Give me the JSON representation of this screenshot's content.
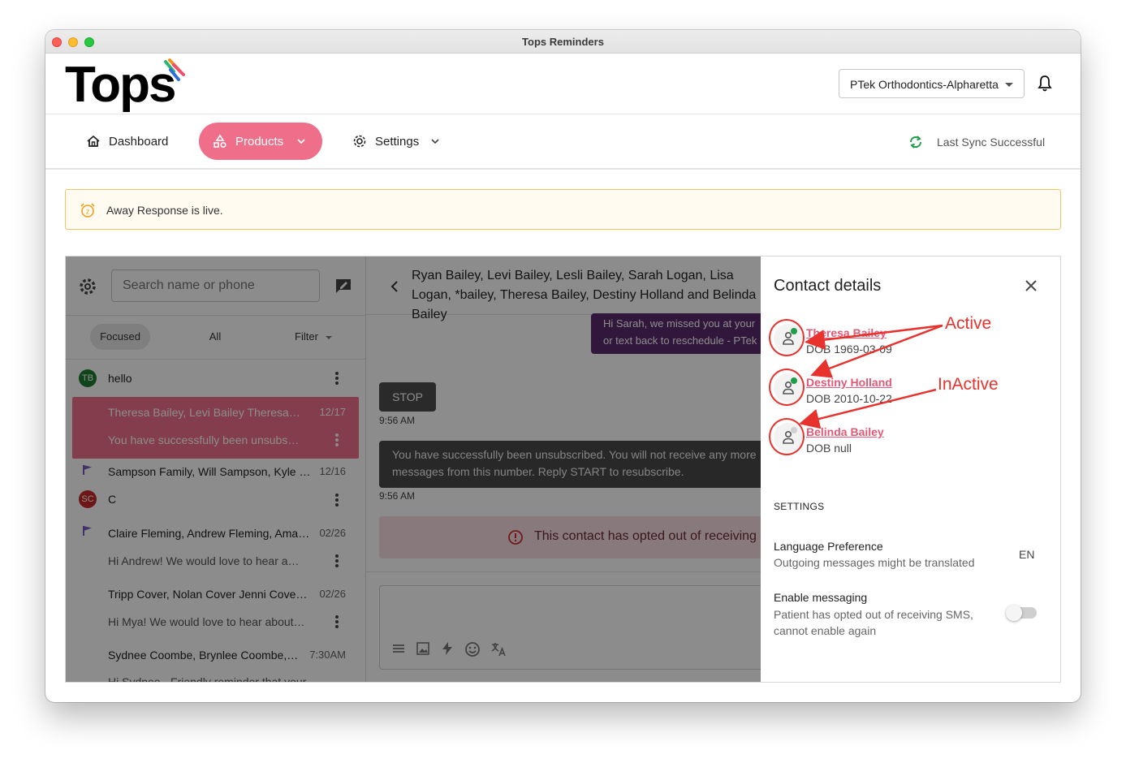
{
  "window": {
    "title": "Tops Reminders"
  },
  "header": {
    "logo_text": "Tops",
    "practice_selector": "PTek Orthodontics-Alpharetta"
  },
  "nav": {
    "dashboard": "Dashboard",
    "products": "Products",
    "settings": "Settings",
    "sync_status": "Last Sync Successful"
  },
  "banner": {
    "text": "Away Response is live."
  },
  "inbox": {
    "search_placeholder": "Search name or phone",
    "tabs": [
      "Focused",
      "All",
      "Filter"
    ],
    "conversations": [
      {
        "avatar": "TB",
        "avatar_color": "#1e7e34",
        "name": "hello",
        "date": "",
        "preview": ""
      },
      {
        "name": "Theresa Bailey, Levi Bailey Theresa Bailey",
        "date": "12/17",
        "preview": "You have successfully been unsubscribed. You will"
      },
      {
        "flag": true,
        "name": "Sampson Family, Will Sampson, Kyle Sampson",
        "date": "12/16",
        "preview": ""
      },
      {
        "avatar": "SC",
        "avatar_color": "#c62828",
        "name": "C",
        "date": "",
        "preview": ""
      },
      {
        "flag": true,
        "name": "Claire Fleming, Andrew Fleming, Amanda Fleming",
        "date": "02/26",
        "preview": "Hi Andrew! We would love to hear about your"
      },
      {
        "name": "Tripp Cover, Nolan Cover Jenni Cover Mya",
        "date": "02/26",
        "preview": "Hi Mya! We would love to hear about your visit"
      },
      {
        "name": "Sydnee Coombe, Brynlee Coombe, Sydnee",
        "date": "7:30AM",
        "preview": "Hi Sydnee - Friendly reminder that your"
      }
    ]
  },
  "chat": {
    "title": "Ryan Bailey, Levi Bailey, Lesli Bailey, Sarah Logan, Lisa Logan, *bailey, Theresa Bailey, Destiny Holland and Belinda Bailey",
    "messages": {
      "outgoing_line1": "Hi Sarah, we missed you at your",
      "outgoing_line2": "or text back to reschedule - PTek",
      "stop": "STOP",
      "stop_time": "9:56 AM",
      "system_line1": "You have successfully been unsubscribed. You will not receive any more",
      "system_line2": "messages from this number. Reply START to resubscribe.",
      "system_time": "9:56 AM"
    },
    "opted_out_notice": "This contact has opted out of receiving"
  },
  "contact_details": {
    "title": "Contact details",
    "contacts": [
      {
        "name": "Theresa Bailey",
        "dob": "DOB 1969-03-09",
        "status_color": "#1e9e4a"
      },
      {
        "name": "Destiny Holland",
        "dob": "DOB 2010-10-22",
        "status_color": "#1e9e4a"
      },
      {
        "name": "Belinda Bailey",
        "dob": "DOB null",
        "status_color": "#d0d0d0"
      }
    ],
    "settings_heading": "SETTINGS",
    "language": {
      "title": "Language Preference",
      "subtitle": "Outgoing messages might be translated",
      "value": "EN"
    },
    "messaging": {
      "title": "Enable messaging",
      "subtitle_line1": "Patient has opted out of receiving SMS,",
      "subtitle_line2": "cannot enable again",
      "enabled": false
    }
  },
  "annotations": {
    "active": "Active",
    "inactive": "InActive"
  },
  "colors": {
    "brand_pink": "#ef6f8a",
    "chat_purple": "#5a2a6e",
    "annotation_red": "#e8322d"
  }
}
